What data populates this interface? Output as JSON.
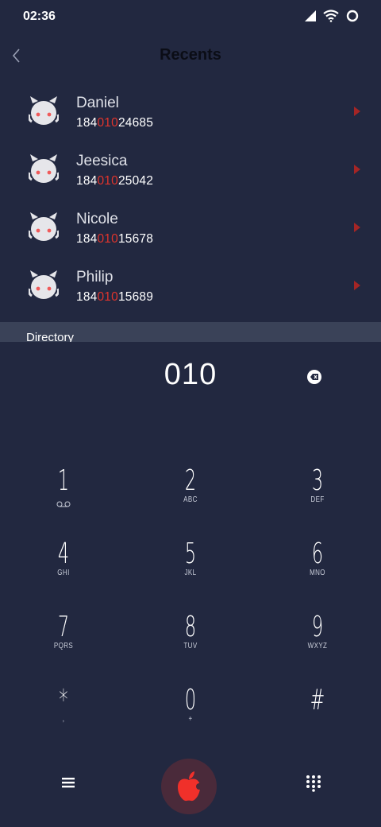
{
  "status_bar": {
    "time": "02:36"
  },
  "header": {
    "title": "Recents"
  },
  "recents": [
    {
      "name": "Daniel",
      "number_prefix": "184",
      "number_match": "010",
      "number_suffix": "24685"
    },
    {
      "name": "Jeesica",
      "number_prefix": "184",
      "number_match": "010",
      "number_suffix": "25042"
    },
    {
      "name": "Nicole",
      "number_prefix": "184",
      "number_match": "010",
      "number_suffix": "15678"
    },
    {
      "name": "Philip",
      "number_prefix": "184",
      "number_match": "010",
      "number_suffix": "15689"
    }
  ],
  "directory": {
    "label": "Directory"
  },
  "entry": {
    "value": "010"
  },
  "keypad": [
    {
      "digit": "1",
      "sub": ""
    },
    {
      "digit": "2",
      "sub": "ABC"
    },
    {
      "digit": "3",
      "sub": "DEF"
    },
    {
      "digit": "4",
      "sub": "GHI"
    },
    {
      "digit": "5",
      "sub": "JKL"
    },
    {
      "digit": "6",
      "sub": "MNO"
    },
    {
      "digit": "7",
      "sub": "PQRS"
    },
    {
      "digit": "8",
      "sub": "TUV"
    },
    {
      "digit": "9",
      "sub": "WXYZ"
    },
    {
      "digit": "*",
      "sub": ","
    },
    {
      "digit": "0",
      "sub": "+"
    },
    {
      "digit": "#",
      "sub": ""
    }
  ],
  "icons": {
    "signal": "signal-icon",
    "wifi": "wifi-icon",
    "status": "circle-status-icon",
    "back": "chevron-left-icon",
    "backspace": "backspace-icon",
    "voicemail": "voicemail-icon",
    "menu": "menu-icon",
    "call": "apple-icon",
    "dialpad": "dialpad-icon",
    "avatar": "avatar-icon"
  },
  "colors": {
    "background": "#222840",
    "accent": "#e0342c",
    "directory_bar": "#3a4258"
  }
}
